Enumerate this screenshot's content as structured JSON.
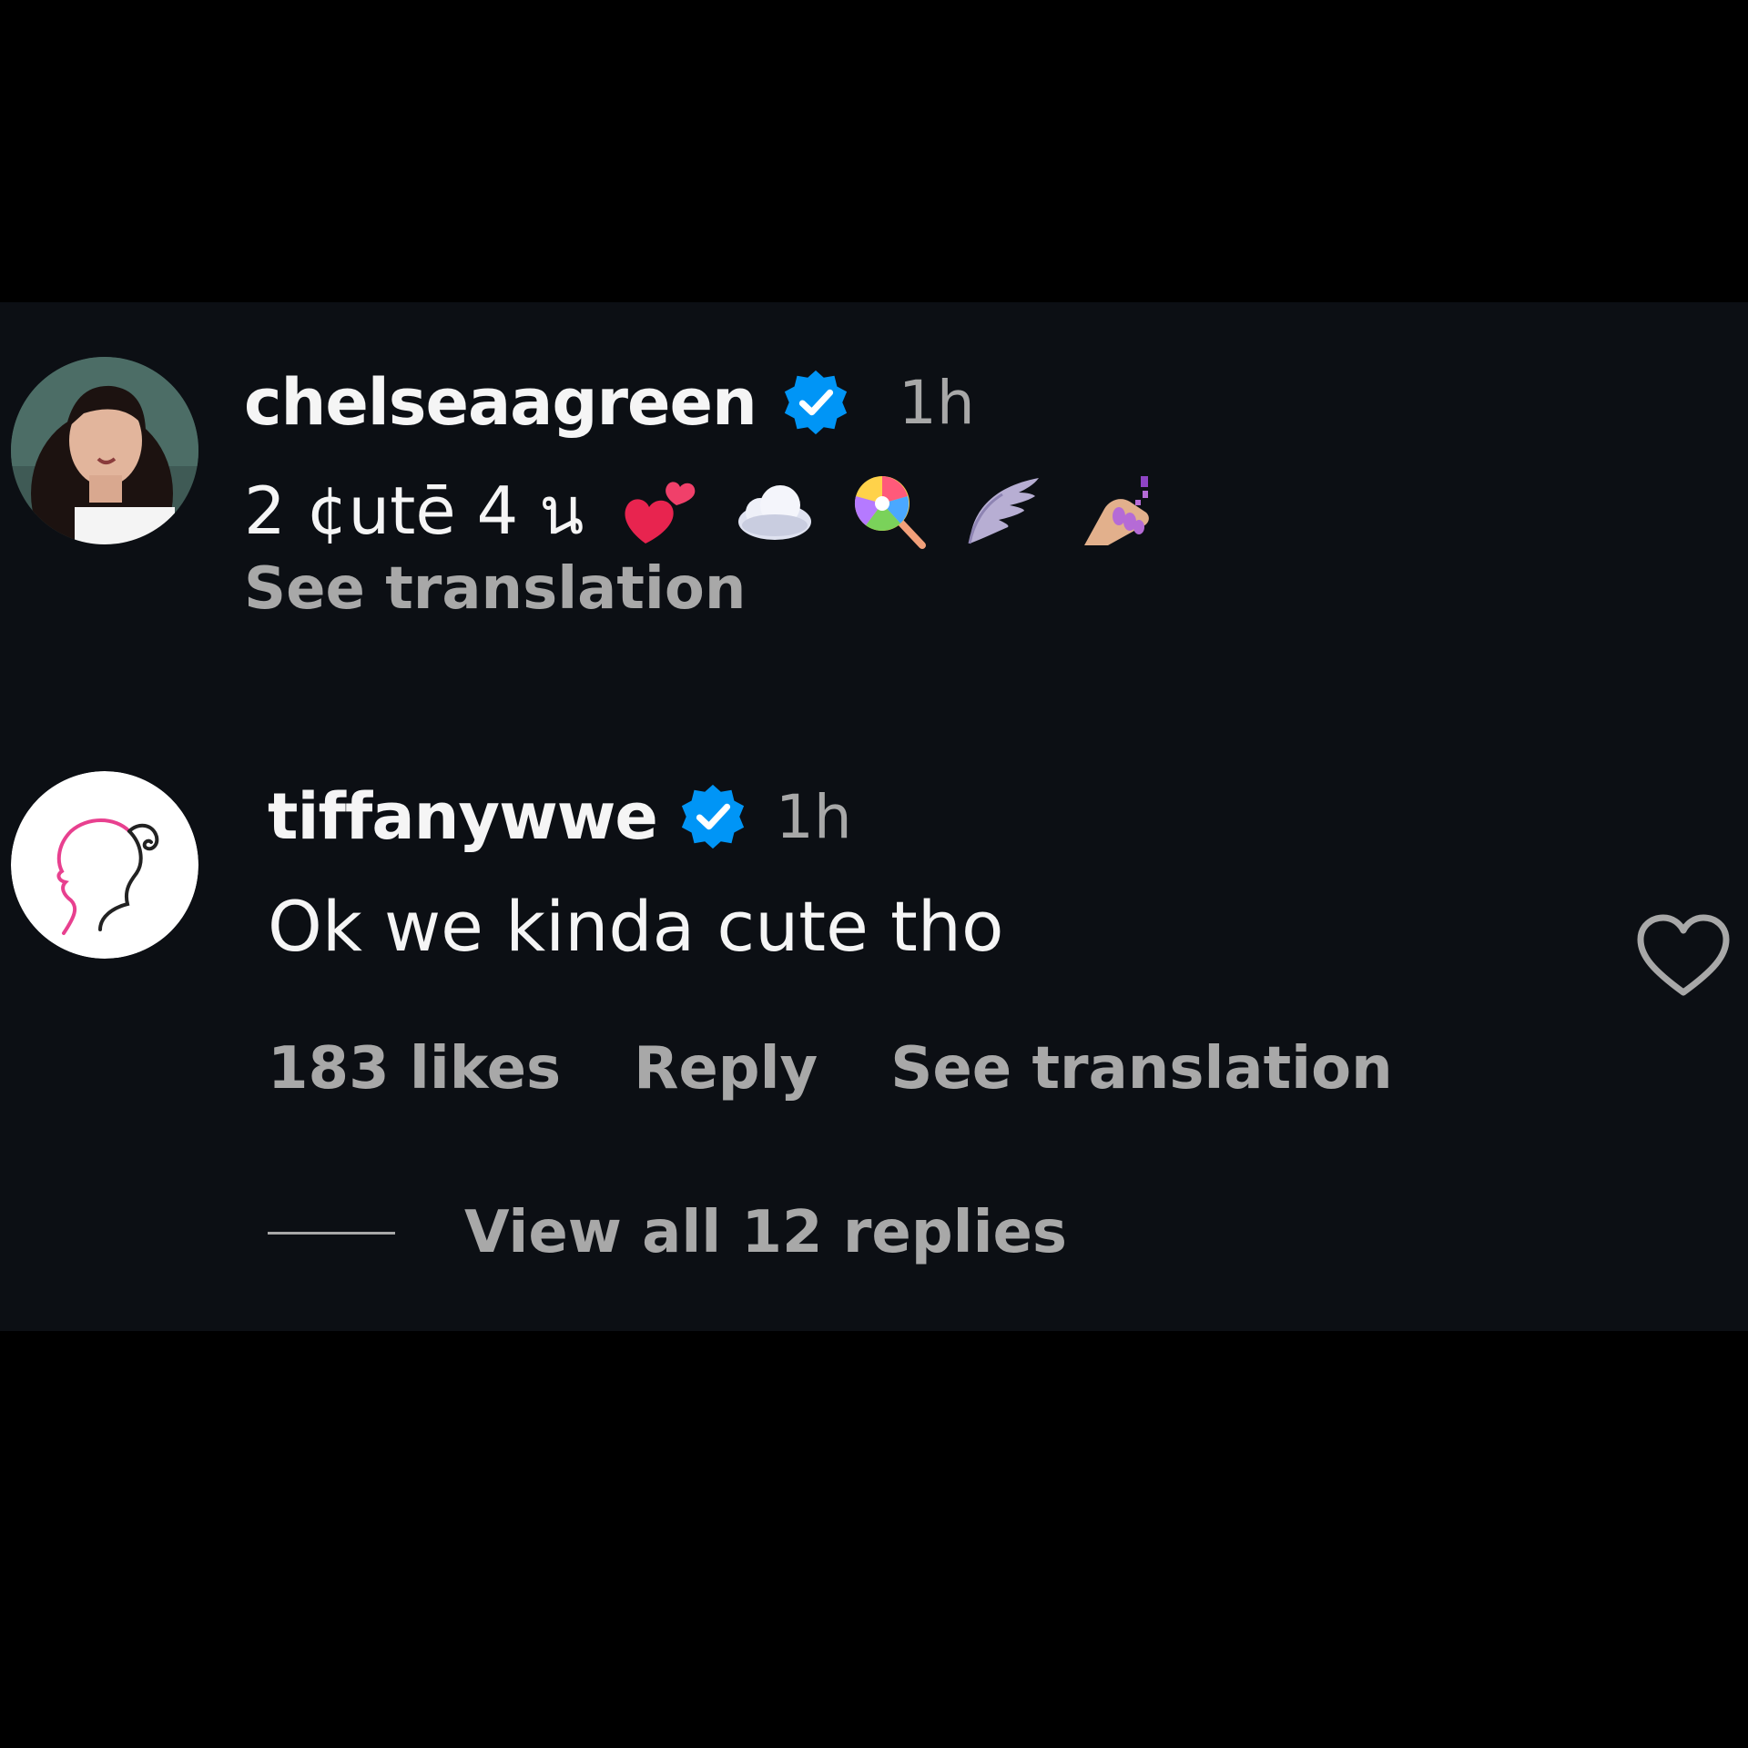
{
  "colors": {
    "panel_background": "#0c0f14",
    "page_background": "#000000",
    "text_primary": "#f5f5f5",
    "text_secondary": "#a8a8a8",
    "verified_blue": "#0095f6",
    "barbie_pink": "#e8408f"
  },
  "comments": [
    {
      "username": "chelseaagreen",
      "verified": true,
      "timestamp": "1h",
      "text": "2 ¢utē 4 น",
      "emojis": [
        "two-hearts-icon",
        "cloud-icon",
        "lollipop-icon",
        "wing-icon",
        "nail-polish-icon"
      ],
      "see_translation": "See translation",
      "avatar": "profile-photo-avatar"
    },
    {
      "username": "tiffanywwe",
      "verified": true,
      "timestamp": "1h",
      "text": "Ok we kinda cute tho",
      "likes": "183 likes",
      "reply": "Reply",
      "see_translation": "See translation",
      "view_replies": "View all 12 replies",
      "avatar": "barbie-silhouette-avatar"
    }
  ]
}
